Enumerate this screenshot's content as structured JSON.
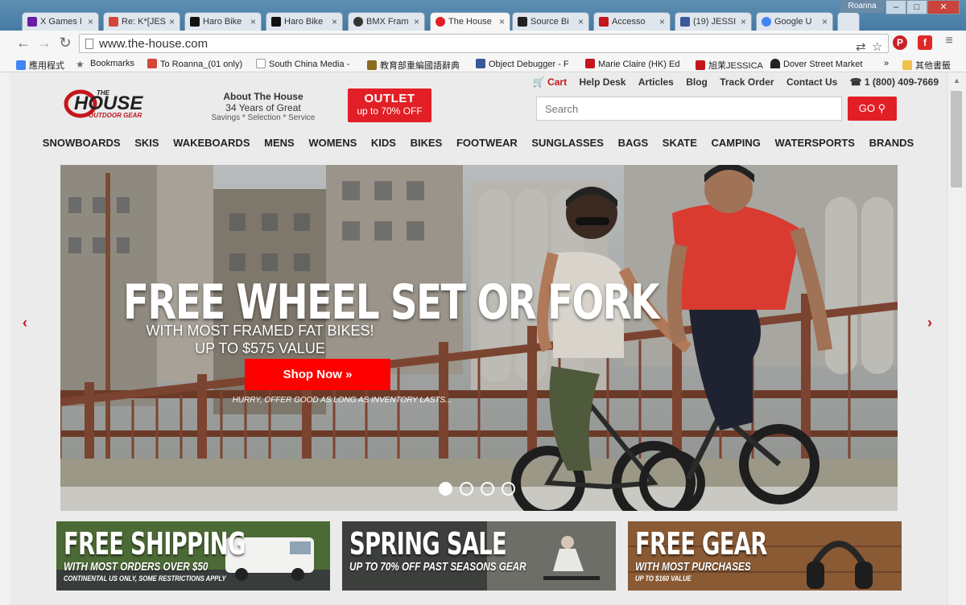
{
  "browser": {
    "tabs": [
      {
        "label": "X Games I",
        "favicon_color": "#6a1ea6"
      },
      {
        "label": "Re: K*[JES",
        "favicon_color": "#d44638"
      },
      {
        "label": "Haro Bike",
        "favicon_color": "#111111"
      },
      {
        "label": "Haro Bike",
        "favicon_color": "#111111"
      },
      {
        "label": "BMX Fram",
        "favicon_color": "#333333"
      },
      {
        "label": "The House",
        "favicon_color": "#e21f26"
      },
      {
        "label": "Source Bi",
        "favicon_color": "#222222"
      },
      {
        "label": "Accesso",
        "favicon_color": "#c4161c"
      },
      {
        "label": "(19) JESSI",
        "favicon_color": "#3b5998"
      },
      {
        "label": "Google U",
        "favicon_color": "#4285f4"
      }
    ],
    "active_tab_index": 5,
    "profile_name": "Roanna",
    "window_controls": {
      "minimize": "–",
      "maximize": "□",
      "close": "✕"
    },
    "url": "www.the-house.com",
    "bookmarks": [
      {
        "label": "應用程式",
        "icon_color": "#4285f4"
      },
      {
        "label": "Bookmarks",
        "icon_color": "#666666"
      },
      {
        "label": "To Roanna_(01 only)",
        "icon_color": "#d44638"
      },
      {
        "label": "South China Media -",
        "icon_color": "#999999"
      },
      {
        "label": "教育部重編國語辭典",
        "icon_color": "#8a6d1f"
      },
      {
        "label": "Object Debugger - F",
        "icon_color": "#3b5998"
      },
      {
        "label": "Marie Claire (HK) Ed",
        "icon_color": "#c4161c"
      },
      {
        "label": "旭茉JESSICA",
        "icon_color": "#c4161c"
      },
      {
        "label": "Dover Street Market",
        "icon_color": "#222222"
      }
    ],
    "more_bookmarks": "»",
    "other_bookmarks": "其他書籤"
  },
  "site": {
    "top_links": {
      "cart": "Cart",
      "help": "Help Desk",
      "articles": "Articles",
      "blog": "Blog",
      "track": "Track Order",
      "contact": "Contact Us",
      "phone": "1 (800) 409-7669"
    },
    "logo": {
      "top": "THE",
      "main": "HOUSE",
      "sub": "OUTDOOR GEAR"
    },
    "about": {
      "line1": "About The House",
      "line2": "34 Years of Great",
      "line3": "Savings * Selection * Service"
    },
    "outlet": {
      "title": "OUTLET",
      "subtitle": "up to 70% OFF"
    },
    "search": {
      "placeholder": "Search",
      "go_label": "GO"
    },
    "nav": [
      "SNOWBOARDS",
      "SKIS",
      "WAKEBOARDS",
      "MENS",
      "WOMENS",
      "KIDS",
      "BIKES",
      "FOOTWEAR",
      "SUNGLASSES",
      "BAGS",
      "SKATE",
      "CAMPING",
      "WATERSPORTS",
      "BRANDS"
    ],
    "hero": {
      "title": "FREE WHEEL SET OR FORK",
      "subtitle1": "WITH MOST FRAMED FAT BIKES!",
      "subtitle2": "UP TO $575 VALUE",
      "cta": "Shop Now »",
      "note": "HURRY, OFFER GOOD AS LONG AS INVENTORY LASTS...",
      "slide_count": 4,
      "active_slide": 1
    },
    "promos": [
      {
        "title": "FREE SHIPPING",
        "subtitle": "WITH MOST ORDERS OVER $50",
        "note": "CONTINENTAL US ONLY, SOME RESTRICTIONS APPLY"
      },
      {
        "title": "SPRING SALE",
        "subtitle": "UP TO 70% OFF PAST SEASONS GEAR",
        "note": ""
      },
      {
        "title": "FREE GEAR",
        "subtitle": "WITH MOST PURCHASES",
        "note": "UP TO $160 VALUE"
      }
    ]
  },
  "colors": {
    "brand_red": "#e21f26",
    "cta_red": "#ff0000",
    "tab_bar": "#467aa3"
  }
}
